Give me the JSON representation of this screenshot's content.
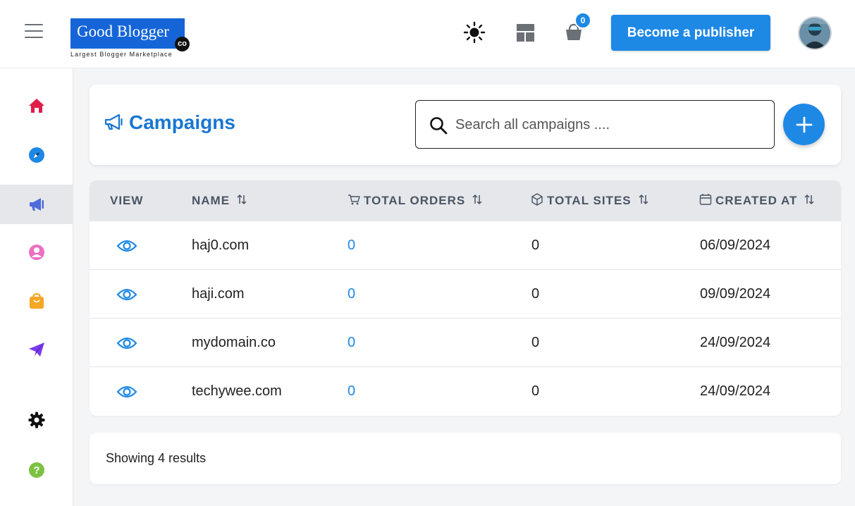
{
  "brand": {
    "name": "Good Blogger",
    "suffix": "CO",
    "tagline": "Largest Blogger Marketplace",
    "color": "#1565d8"
  },
  "header": {
    "cart_count": "0",
    "publisher_button": "Become a publisher",
    "icons": [
      "menu-icon",
      "sun-icon",
      "layout-icon",
      "cart-icon",
      "avatar"
    ]
  },
  "sidebar": {
    "items": [
      {
        "icon": "home-icon",
        "color": "#e11d48"
      },
      {
        "icon": "compass-icon",
        "color": "#1e88e5"
      },
      {
        "icon": "megaphone-icon",
        "color": "#4f6bdc",
        "active": true
      },
      {
        "icon": "user-icon",
        "color": "#ec6fc1"
      },
      {
        "icon": "shopping-bag-icon",
        "color": "#f5a623"
      },
      {
        "icon": "paper-plane-icon",
        "color": "#7c3aed"
      },
      {
        "icon": "gear-icon",
        "color": "#111111"
      },
      {
        "icon": "help-icon",
        "color": "#7cc242"
      }
    ]
  },
  "page": {
    "title": "Campaigns",
    "search_placeholder": "Search all campaigns ....",
    "accent": "#1e88e5"
  },
  "table": {
    "columns": [
      "VIEW",
      "NAME",
      "TOTAL ORDERS",
      "TOTAL SITES",
      "CREATED AT"
    ],
    "rows": [
      {
        "name": "haj0.com",
        "orders": "0",
        "sites": "0",
        "created": "06/09/2024"
      },
      {
        "name": "haji.com",
        "orders": "0",
        "sites": "0",
        "created": "09/09/2024"
      },
      {
        "name": "mydomain.co",
        "orders": "0",
        "sites": "0",
        "created": "24/09/2024"
      },
      {
        "name": "techywee.com",
        "orders": "0",
        "sites": "0",
        "created": "24/09/2024"
      }
    ]
  },
  "footer": {
    "results_text": "Showing 4 results"
  }
}
